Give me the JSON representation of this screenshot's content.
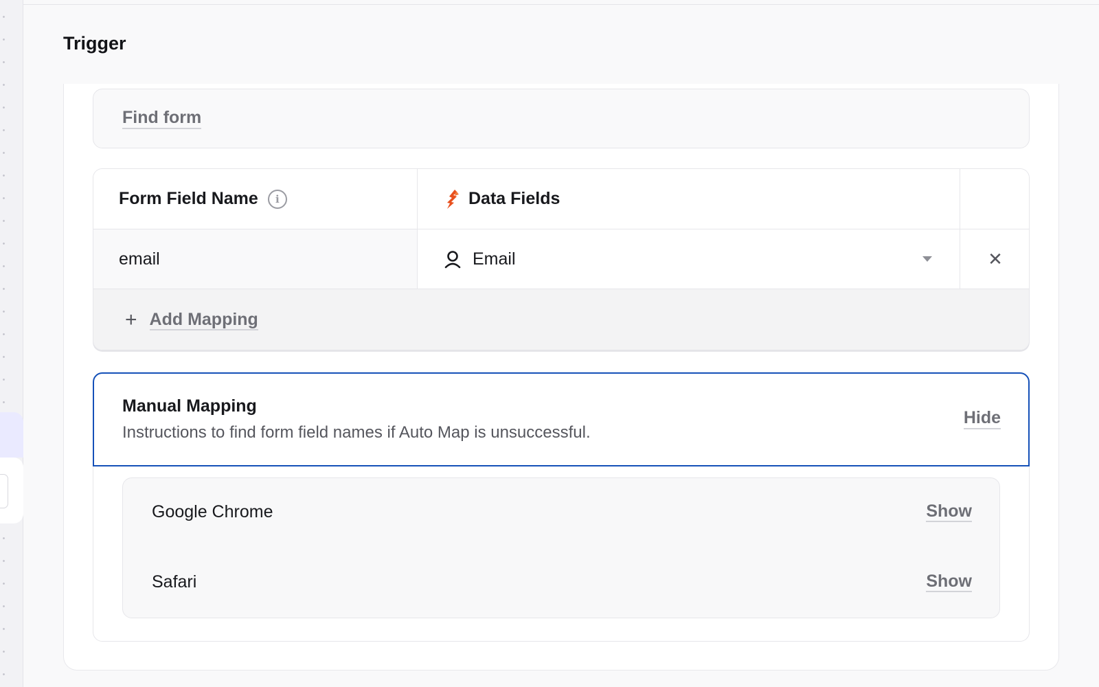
{
  "section": {
    "title": "Trigger"
  },
  "find_form": {
    "label": "Find form"
  },
  "mapping_table": {
    "headers": {
      "form_field_name": "Form Field Name",
      "data_fields": "Data Fields"
    },
    "rows": [
      {
        "form_field": "email",
        "data_field": "Email"
      }
    ],
    "add_label": "Add Mapping"
  },
  "manual_mapping": {
    "title": "Manual Mapping",
    "description": "Instructions to find form field names if Auto Map is unsuccessful.",
    "toggle_label": "Hide",
    "browsers": [
      {
        "name": "Google Chrome",
        "action": "Show"
      },
      {
        "name": "Safari",
        "action": "Show"
      }
    ]
  },
  "icons": {
    "info": "info-circle-icon",
    "brand": "brand-logo-icon",
    "person": "person-icon",
    "caret": "chevron-down-icon",
    "remove": "close-icon",
    "add": "plus-icon"
  },
  "colors": {
    "accent_border": "#1450b8",
    "brand_orange": "#e8501e",
    "link_gray": "#6e6f76"
  }
}
